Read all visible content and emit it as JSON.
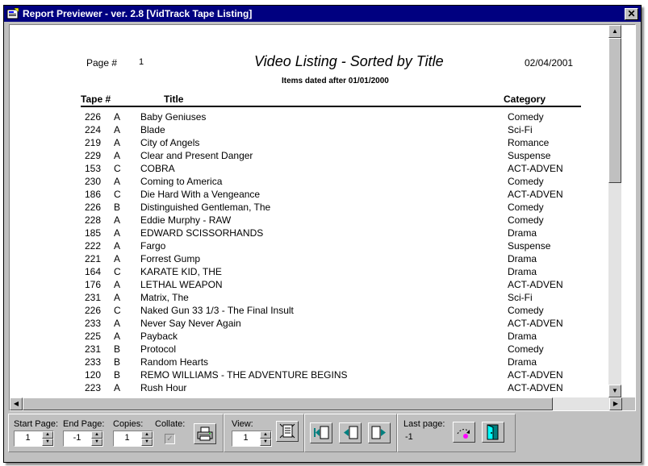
{
  "window": {
    "title": "Report Previewer - ver. 2.8    [VidTrack Tape Listing]",
    "close_glyph": "✕"
  },
  "report": {
    "page_label": "Page #",
    "page_number": "1",
    "title": "Video Listing - Sorted by Title",
    "date": "02/04/2001",
    "subtitle": "Items dated after 01/01/2000",
    "columns": {
      "tape": "Tape #",
      "title": "Title",
      "category": "Category"
    },
    "rows": [
      {
        "tape": "226",
        "suffix": "A",
        "title": "Baby Geniuses",
        "category": "Comedy"
      },
      {
        "tape": "224",
        "suffix": "A",
        "title": "Blade",
        "category": "Sci-Fi"
      },
      {
        "tape": "219",
        "suffix": "A",
        "title": "City of Angels",
        "category": "Romance"
      },
      {
        "tape": "229",
        "suffix": "A",
        "title": "Clear and Present Danger",
        "category": "Suspense"
      },
      {
        "tape": "153",
        "suffix": "C",
        "title": "COBRA",
        "category": "ACT-ADVEN"
      },
      {
        "tape": "230",
        "suffix": "A",
        "title": "Coming to America",
        "category": "Comedy"
      },
      {
        "tape": "186",
        "suffix": "C",
        "title": "Die Hard With a Vengeance",
        "category": "ACT-ADVEN"
      },
      {
        "tape": "226",
        "suffix": "B",
        "title": "Distinguished Gentleman, The",
        "category": "Comedy"
      },
      {
        "tape": "228",
        "suffix": "A",
        "title": "Eddie Murphy - RAW",
        "category": "Comedy"
      },
      {
        "tape": "185",
        "suffix": "A",
        "title": "EDWARD SCISSORHANDS",
        "category": "Drama"
      },
      {
        "tape": "222",
        "suffix": "A",
        "title": "Fargo",
        "category": "Suspense"
      },
      {
        "tape": "221",
        "suffix": "A",
        "title": "Forrest Gump",
        "category": "Drama"
      },
      {
        "tape": "164",
        "suffix": "C",
        "title": "KARATE KID, THE",
        "category": "Drama"
      },
      {
        "tape": "176",
        "suffix": "A",
        "title": "LETHAL WEAPON",
        "category": "ACT-ADVEN"
      },
      {
        "tape": "231",
        "suffix": "A",
        "title": "Matrix, The",
        "category": "Sci-Fi"
      },
      {
        "tape": "226",
        "suffix": "C",
        "title": "Naked Gun 33 1/3 - The Final Insult",
        "category": "Comedy"
      },
      {
        "tape": "233",
        "suffix": "A",
        "title": "Never Say Never Again",
        "category": "ACT-ADVEN"
      },
      {
        "tape": "225",
        "suffix": "A",
        "title": "Payback",
        "category": "Drama"
      },
      {
        "tape": "231",
        "suffix": "B",
        "title": "Protocol",
        "category": "Comedy"
      },
      {
        "tape": "233",
        "suffix": "B",
        "title": "Random Hearts",
        "category": "Drama"
      },
      {
        "tape": "120",
        "suffix": "B",
        "title": "REMO WILLIAMS - THE ADVENTURE BEGINS",
        "category": "ACT-ADVEN"
      },
      {
        "tape": "223",
        "suffix": "A",
        "title": "Rush Hour",
        "category": "ACT-ADVEN"
      }
    ]
  },
  "toolbar": {
    "start_page_label": "Start Page:",
    "start_page_value": "1",
    "end_page_label": "End Page:",
    "end_page_value": "-1",
    "copies_label": "Copies:",
    "copies_value": "1",
    "collate_label": "Collate:",
    "collate_checked": true,
    "view_label": "View:",
    "view_value": "1",
    "last_page_label": "Last page:",
    "last_page_value": "-1",
    "icons": [
      "printer-icon",
      "page-setup-icon",
      "first-page-icon",
      "previous-page-icon",
      "next-page-icon",
      "goto-page-icon",
      "exit-door-icon"
    ]
  },
  "colors": {
    "titlebar": "#000080",
    "face": "#c0c0c0",
    "accent": "#008080"
  }
}
